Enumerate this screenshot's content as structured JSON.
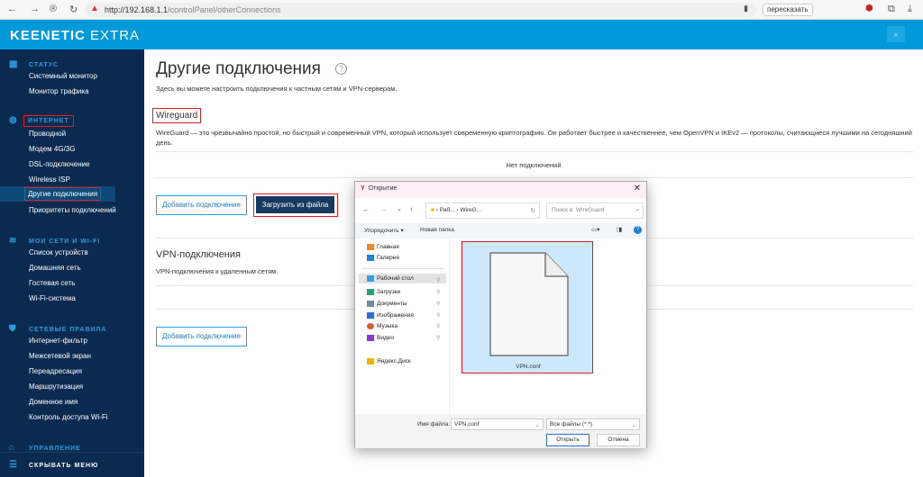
{
  "browser": {
    "url_host": "http://192.168.1.1",
    "url_path": "/controlPanel/otherConnections",
    "translate_label": "пересказать"
  },
  "header": {
    "logo_bold": "KEENETIC",
    "logo_light": "EXTRA"
  },
  "sidebar": {
    "sections": [
      {
        "title": "СТАТУС",
        "items": [
          "Системный монитор",
          "Монитор трафика"
        ]
      },
      {
        "title": "ИНТЕРНЕТ",
        "items": [
          "Проводной",
          "Модем 4G/3G",
          "DSL-подключение",
          "Wireless ISP",
          "Другие подключения",
          "Приоритеты подключений"
        ]
      },
      {
        "title": "МОИ СЕТИ И WI-FI",
        "items": [
          "Список устройств",
          "Домашняя сеть",
          "Гостевая сеть",
          "Wi-Fi-система"
        ]
      },
      {
        "title": "СЕТЕВЫЕ ПРАВИЛА",
        "items": [
          "Интернет-фильтр",
          "Межсетевой экран",
          "Переадресация",
          "Маршрутизация",
          "Доменное имя",
          "Контроль доступа Wi-Fi"
        ]
      },
      {
        "title": "УПРАВЛЕНИЕ",
        "items": []
      }
    ],
    "hide_menu": "СКРЫВАТЬ МЕНЮ"
  },
  "main": {
    "title": "Другие подключения",
    "help": "?",
    "subtitle": "Здесь вы можете настроить подключения к частным сетям и VPN-серверам.",
    "wireguard": {
      "title": "Wireguard",
      "description": "WireGuard — это чрезвычайно простой, но быстрый и современный VPN, который использует современную криптографию. Он работает быстрее и качественнее, чем OpenVPN и IKEv2 — протоколы, считающиеся лучшими на сегодняшний день.",
      "empty": "Нет подключений",
      "add": "Добавить подключение",
      "upload": "Загрузить из файла"
    },
    "vpn": {
      "title": "VPN-подключения",
      "description": "VPN-подключения к удаленным сетям.",
      "add": "Добавить подключение"
    }
  },
  "dialog": {
    "title": "Открытие",
    "path": [
      "Раб...",
      "WireG..."
    ],
    "search_placeholder": "Поиск в: WireGuard",
    "organize": "Упорядочить ▾",
    "new_folder": "Новая папка",
    "tree": [
      "Главная",
      "Галерея",
      "Рабочий стол",
      "Загрузки",
      "Документы",
      "Изображения",
      "Музыка",
      "Видео",
      "Яндекс.Диск"
    ],
    "file": "VPN.conf",
    "filename_label": "Имя файла:",
    "filename_value": "VPN.conf",
    "filetype": "Все файлы (*.*)",
    "open": "Открыть",
    "cancel": "Отмена"
  }
}
